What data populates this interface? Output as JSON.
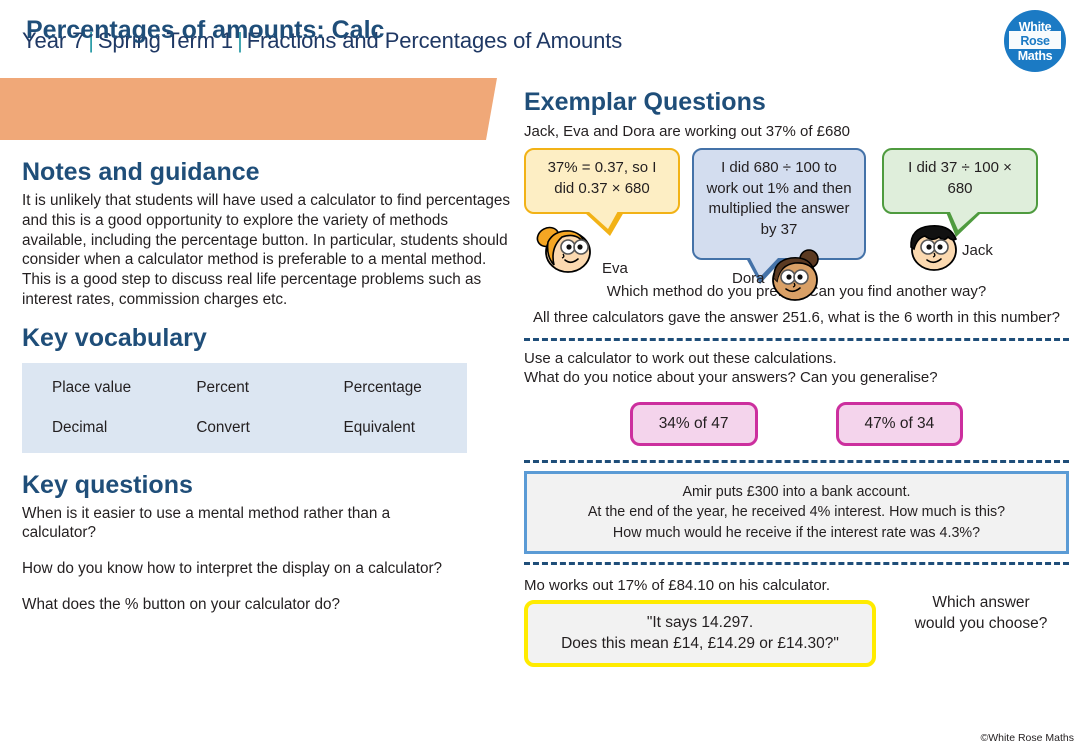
{
  "header": {
    "year": "Year 7",
    "term": "Spring Term 1",
    "topic": "Fractions and Percentages of Amounts",
    "separator": "|",
    "logo": {
      "line1": "White",
      "line2": "Rose",
      "line3": "Maths"
    }
  },
  "banner": {
    "title": "Percentages of amounts: Calc",
    "color": "#f0a878"
  },
  "notes": {
    "heading": "Notes and guidance",
    "body": "It is unlikely that students will have used a calculator to find percentages and this is a good opportunity to explore the variety of methods available, including the percentage button. In particular, students should consider when a calculator method is preferable to a mental method. This is a good step to discuss real life percentage problems such as interest rates, commission charges etc."
  },
  "vocabulary": {
    "heading": "Key vocabulary",
    "rows": [
      [
        "Place value",
        "Percent",
        "Percentage"
      ],
      [
        "Decimal",
        "Convert",
        "Equivalent"
      ]
    ]
  },
  "key_questions": {
    "heading": "Key questions",
    "items": [
      "When is it easier to use a mental method rather than a calculator?",
      "How do you know how to interpret the display on a calculator?",
      "What does the % button on your calculator do?"
    ]
  },
  "exemplar": {
    "heading": "Exemplar Questions",
    "intro": "Jack, Eva and Dora are working out 37% of £680",
    "bubbles": [
      {
        "name": "Eva",
        "text": "37% = 0.37, so I did 0.37 × 680",
        "fill": "#fdeec4",
        "stroke": "#f2b216"
      },
      {
        "name": "Dora",
        "text": "I did 680 ÷ 100 to work out 1% and then multiplied the answer by 37",
        "fill": "#d3ddef",
        "stroke": "#4472a8"
      },
      {
        "name": "Jack",
        "text": "I did 37 ÷ 100 × 680",
        "fill": "#dfeedb",
        "stroke": "#4f9b3f"
      }
    ],
    "prompt_line1": "Which method do you prefer? Can you find another way?",
    "prompt_line2": "All three calculators gave the answer 251.6, what is the 6 worth in this number?",
    "calc_prompt_line1": "Use a calculator to work out these calculations.",
    "calc_prompt_line2": "What do you notice about your answers? Can you generalise?",
    "calc_boxes": [
      "34% of 47",
      "47% of 34"
    ],
    "info_box": {
      "line1": "Amir puts £300 into a bank account.",
      "line2": "At the end of the year, he received 4% interest. How much is this?",
      "line3": "How much would he receive if the interest rate was 4.3%?"
    },
    "mo_line": "Mo works out 17% of £84.10 on his calculator.",
    "mo_quote_line1": "\"It says 14.297.",
    "mo_quote_line2": "Does this mean £14, £14.29 or £14.30?\"",
    "which_answer_line1": "Which answer",
    "which_answer_line2": "would you choose?"
  },
  "footer": {
    "copyright": "©White Rose Maths"
  }
}
